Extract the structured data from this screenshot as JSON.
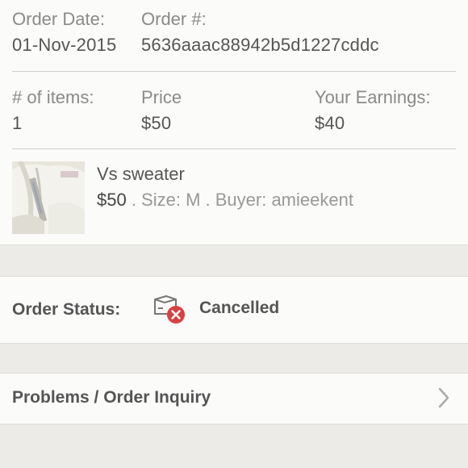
{
  "order": {
    "date_label": "Order Date:",
    "date_value": "01-Nov-2015",
    "number_label": "Order #:",
    "number_value": "5636aaac88942b5d1227cddc",
    "items_label": "# of items:",
    "items_value": "1",
    "price_label": "Price",
    "price_value": "$50",
    "earnings_label": "Your Earnings:",
    "earnings_value": "$40"
  },
  "item": {
    "title": "Vs sweater",
    "price": "$50",
    "size_text": " . Size: M",
    "buyer_text": " . Buyer: amieekent",
    "thumbnail": "sweater-photo"
  },
  "status": {
    "label": "Order Status:",
    "value": "Cancelled",
    "icon": "package-cancelled-icon",
    "icon_color": "#d94040"
  },
  "inquiry": {
    "label": "Problems / Order Inquiry",
    "icon": "chevron-right-icon"
  }
}
